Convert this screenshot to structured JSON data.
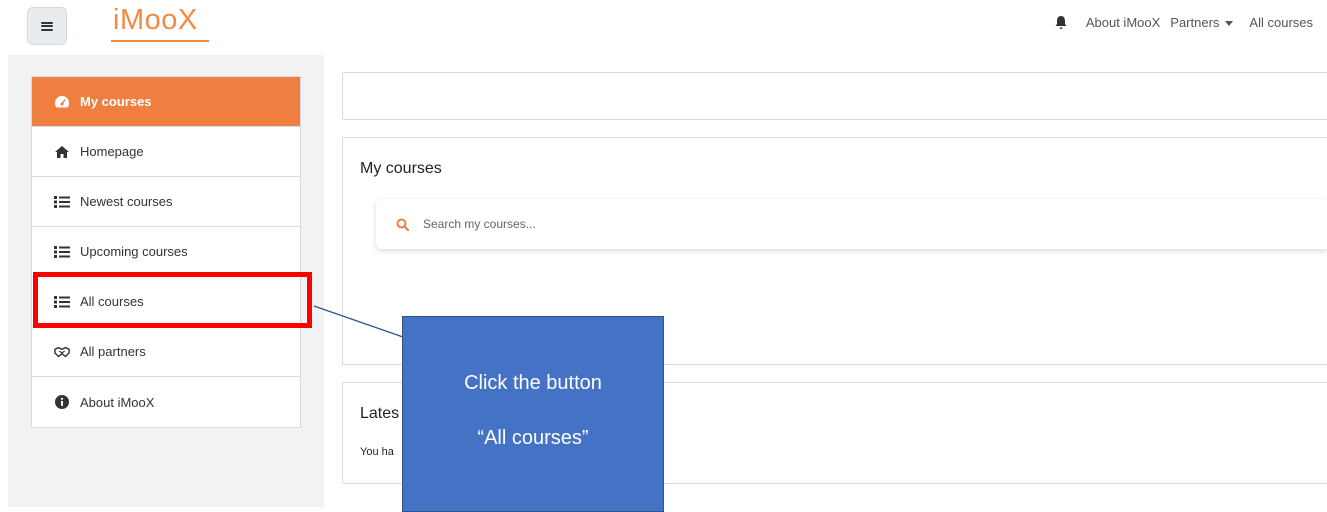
{
  "header": {
    "logo": "iMooX",
    "nav": [
      {
        "label": "About iMooX"
      },
      {
        "label": "Partners"
      },
      {
        "label": "All courses"
      }
    ],
    "icons": {
      "menu": "hamburger-icon",
      "notifications": "bell-icon"
    }
  },
  "sidebar": {
    "items": [
      {
        "label": "My courses",
        "icon": "dashboard-icon",
        "active": true
      },
      {
        "label": "Homepage",
        "icon": "home-icon"
      },
      {
        "label": "Newest courses",
        "icon": "list-icon"
      },
      {
        "label": "Upcoming courses",
        "icon": "list-icon"
      },
      {
        "label": "All courses",
        "icon": "list-icon"
      },
      {
        "label": "All partners",
        "icon": "handshake-icon"
      },
      {
        "label": "About iMooX",
        "icon": "info-icon"
      }
    ]
  },
  "main": {
    "my_courses_title": "My courses",
    "search_placeholder": "Search my courses...",
    "latest_title": "Lates",
    "latest_text": "You ha"
  },
  "annotation": {
    "line1": "Click the button",
    "line2": "“All courses”"
  },
  "colors": {
    "accent": "#ef7f40",
    "highlight": "#ff0000",
    "callout": "#4472c4"
  }
}
